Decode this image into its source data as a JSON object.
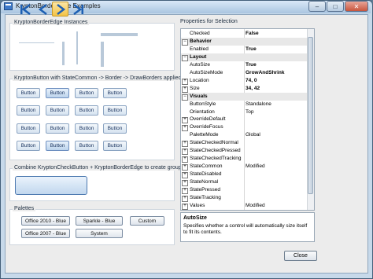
{
  "window": {
    "title": "KryptonBorderEdge Examples",
    "minimize_glyph": "–",
    "maximize_glyph": "□",
    "close_glyph": "✕"
  },
  "groups": {
    "instances_title": "KryptonBorderEdge Instances",
    "statecommon_title": "KryptonButton with StateCommon -> Border -> DrawBorders applied",
    "checkbutton_title": "Combine KryptonCheckButton + KryptonBorderEdge to create group",
    "palettes_title": "Palettes"
  },
  "buttons_grid": [
    [
      "Button",
      "Button",
      "Button",
      "Button"
    ],
    [
      "Button",
      "Button",
      "Button",
      "Button"
    ],
    [
      "Button",
      "Button",
      "Button",
      "Button"
    ],
    [
      "Button",
      "Button",
      "Button",
      "Button"
    ]
  ],
  "nav_buttons": [
    "first-icon",
    "previous-icon",
    "next-icon",
    "last-icon"
  ],
  "palettes": {
    "office2010": "Office 2010 - Blue",
    "sparkle": "Sparkle - Blue",
    "custom": "Custom",
    "office2007": "Office 2007 - Blue",
    "system": "System"
  },
  "properties": {
    "title": "Properties for Selection",
    "rows": [
      {
        "type": "prop",
        "label": "Checked",
        "value": "False",
        "bold": true
      },
      {
        "type": "cat",
        "label": "Behavior",
        "expander": "−"
      },
      {
        "type": "prop",
        "label": "Enabled",
        "value": "True",
        "bold": true
      },
      {
        "type": "cat",
        "label": "Layout",
        "expander": "−"
      },
      {
        "type": "prop",
        "label": "AutoSize",
        "value": "True",
        "bold": true
      },
      {
        "type": "prop",
        "label": "AutoSizeMode",
        "value": "GrowAndShrink",
        "bold": true
      },
      {
        "type": "prop",
        "label": "Location",
        "value": "74, 0",
        "bold": true,
        "expander": "+"
      },
      {
        "type": "prop",
        "label": "Size",
        "value": "34, 42",
        "bold": true,
        "expander": "+"
      },
      {
        "type": "cat",
        "label": "Visuals",
        "expander": "−"
      },
      {
        "type": "prop",
        "label": "ButtonStyle",
        "value": "Standalone"
      },
      {
        "type": "prop",
        "label": "Orientation",
        "value": "Top"
      },
      {
        "type": "prop",
        "label": "OverrideDefault",
        "value": "",
        "expander": "+"
      },
      {
        "type": "prop",
        "label": "OverrideFocus",
        "value": "",
        "expander": "+"
      },
      {
        "type": "prop",
        "label": "PaletteMode",
        "value": "Global"
      },
      {
        "type": "prop",
        "label": "StateCheckedNormal",
        "value": "",
        "expander": "+"
      },
      {
        "type": "prop",
        "label": "StateCheckedPressed",
        "value": "",
        "expander": "+"
      },
      {
        "type": "prop",
        "label": "StateCheckedTracking",
        "value": "",
        "expander": "+"
      },
      {
        "type": "prop",
        "label": "StateCommon",
        "value": "Modified",
        "expander": "+"
      },
      {
        "type": "prop",
        "label": "StateDisabled",
        "value": "",
        "expander": "+"
      },
      {
        "type": "prop",
        "label": "StateNormal",
        "value": "",
        "expander": "+"
      },
      {
        "type": "prop",
        "label": "StatePressed",
        "value": "",
        "expander": "+"
      },
      {
        "type": "prop",
        "label": "StateTracking",
        "value": "",
        "expander": "+"
      },
      {
        "type": "prop",
        "label": "Values",
        "value": "Modified",
        "expander": "+"
      }
    ],
    "desc_title": "AutoSize",
    "desc_text": "Specifies whether a control will automatically size itself to fit its contents."
  },
  "close_label": "Close",
  "colors": {
    "accent": "#4d79b0",
    "nav_checked": "#f6c94a"
  }
}
